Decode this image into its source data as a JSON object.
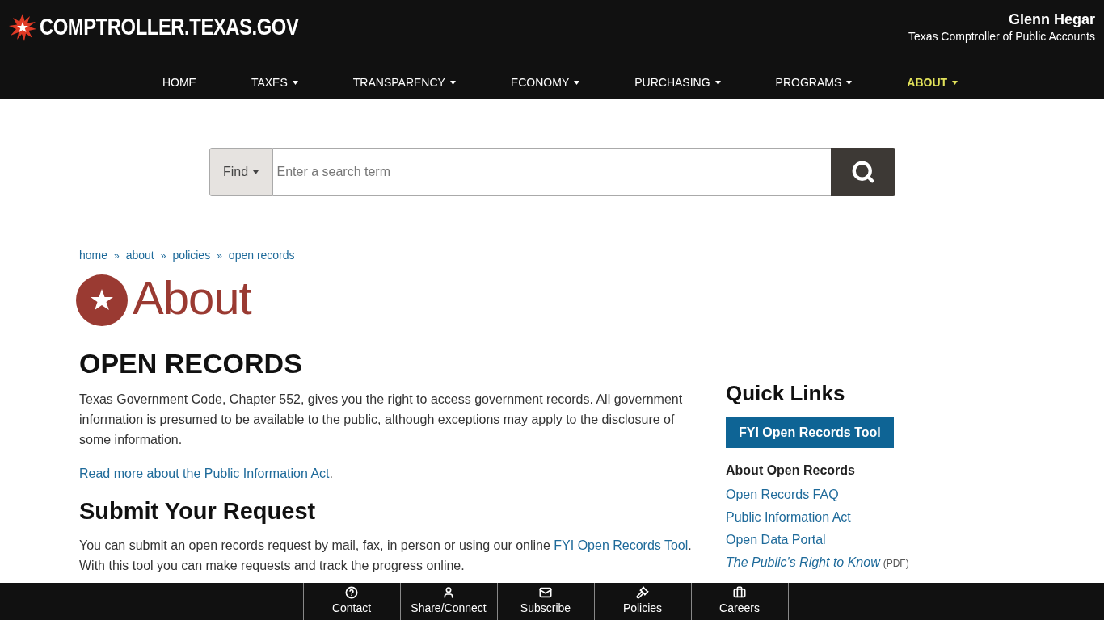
{
  "header": {
    "logo": "COMPTROLLER.TEXAS.GOV",
    "person_name": "Glenn Hegar",
    "person_title": "Texas Comptroller of Public Accounts"
  },
  "nav": [
    {
      "label": "HOME",
      "dropdown": false,
      "selected": false
    },
    {
      "label": "TAXES",
      "dropdown": true,
      "selected": false
    },
    {
      "label": "TRANSPARENCY",
      "dropdown": true,
      "selected": false
    },
    {
      "label": "ECONOMY",
      "dropdown": true,
      "selected": false
    },
    {
      "label": "PURCHASING",
      "dropdown": true,
      "selected": false
    },
    {
      "label": "PROGRAMS",
      "dropdown": true,
      "selected": false
    },
    {
      "label": "ABOUT",
      "dropdown": true,
      "selected": true
    }
  ],
  "search": {
    "scope": "Find",
    "placeholder": "Enter a search term"
  },
  "breadcrumb": [
    "home",
    "about",
    "policies",
    "open records"
  ],
  "breadcrumb_separator": "»",
  "section_title": "About",
  "page_title": "OPEN RECORDS",
  "intro": "Texas Government Code, Chapter 552, gives you the right to access government records. All government information is presumed to be available to the public, although exceptions may apply to the disclosure of some information.",
  "read_more": {
    "link": "Read more about the Public Information Act",
    "after": "."
  },
  "submit": {
    "heading": "Submit Your Request",
    "before": "You can submit an open records request by mail, fax, in person or using our online ",
    "link": "FYI Open Records Tool",
    "after": ". With this tool you can make requests and track the progress online."
  },
  "quick_links": {
    "title": "Quick Links",
    "button": "FYI Open Records Tool",
    "subheading": "About Open Records",
    "links": [
      {
        "label": "Open Records FAQ",
        "kind": "plain"
      },
      {
        "label": "Public Information Act",
        "kind": "plain"
      },
      {
        "label": "Open Data Portal",
        "kind": "plain"
      },
      {
        "label": "The Public's Right to Know",
        "kind": "pdf",
        "note": "(PDF)"
      }
    ]
  },
  "footer": [
    {
      "label": "Contact"
    },
    {
      "label": "Share/Connect"
    },
    {
      "label": "Subscribe"
    },
    {
      "label": "Policies"
    },
    {
      "label": "Careers"
    }
  ]
}
